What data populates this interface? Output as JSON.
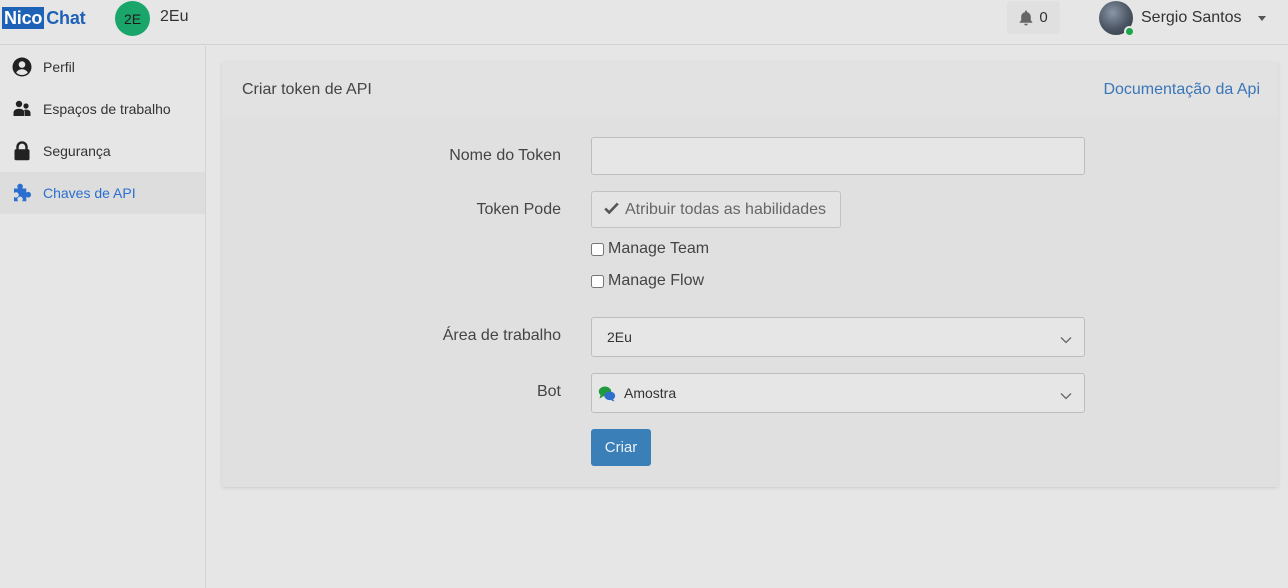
{
  "brand": {
    "part1": "Nico",
    "part2": "Chat"
  },
  "workspace": {
    "initials": "2E",
    "name": "2Eu"
  },
  "notifications": {
    "count": "0"
  },
  "user": {
    "name": "Sergio Santos"
  },
  "sidebar": {
    "items": [
      {
        "label": "Perfil",
        "icon": "user-circle-icon"
      },
      {
        "label": "Espaços de trabalho",
        "icon": "users-icon"
      },
      {
        "label": "Segurança",
        "icon": "lock-icon"
      },
      {
        "label": "Chaves de API",
        "icon": "puzzle-icon",
        "active": true
      }
    ]
  },
  "card": {
    "title": "Criar token de API",
    "doc_link": "Documentação da Api"
  },
  "form": {
    "token_name_label": "Nome do Token",
    "token_name_value": "",
    "token_can_label": "Token Pode",
    "assign_all_label": "Atribuir todas as habilidades",
    "abilities": [
      {
        "label": "Manage Team",
        "checked": false
      },
      {
        "label": "Manage Flow",
        "checked": false
      }
    ],
    "workspace_label": "Área de trabalho",
    "workspace_value": "2Eu",
    "bot_label": "Bot",
    "bot_value": "Amostra",
    "create_label": "Criar"
  },
  "colors": {
    "brand": "#1e62b8",
    "accent": "#3b7fb8",
    "active_nav": "#2a6fd0",
    "workspace_avatar": "#1aa66b",
    "online": "#1aa64b"
  }
}
